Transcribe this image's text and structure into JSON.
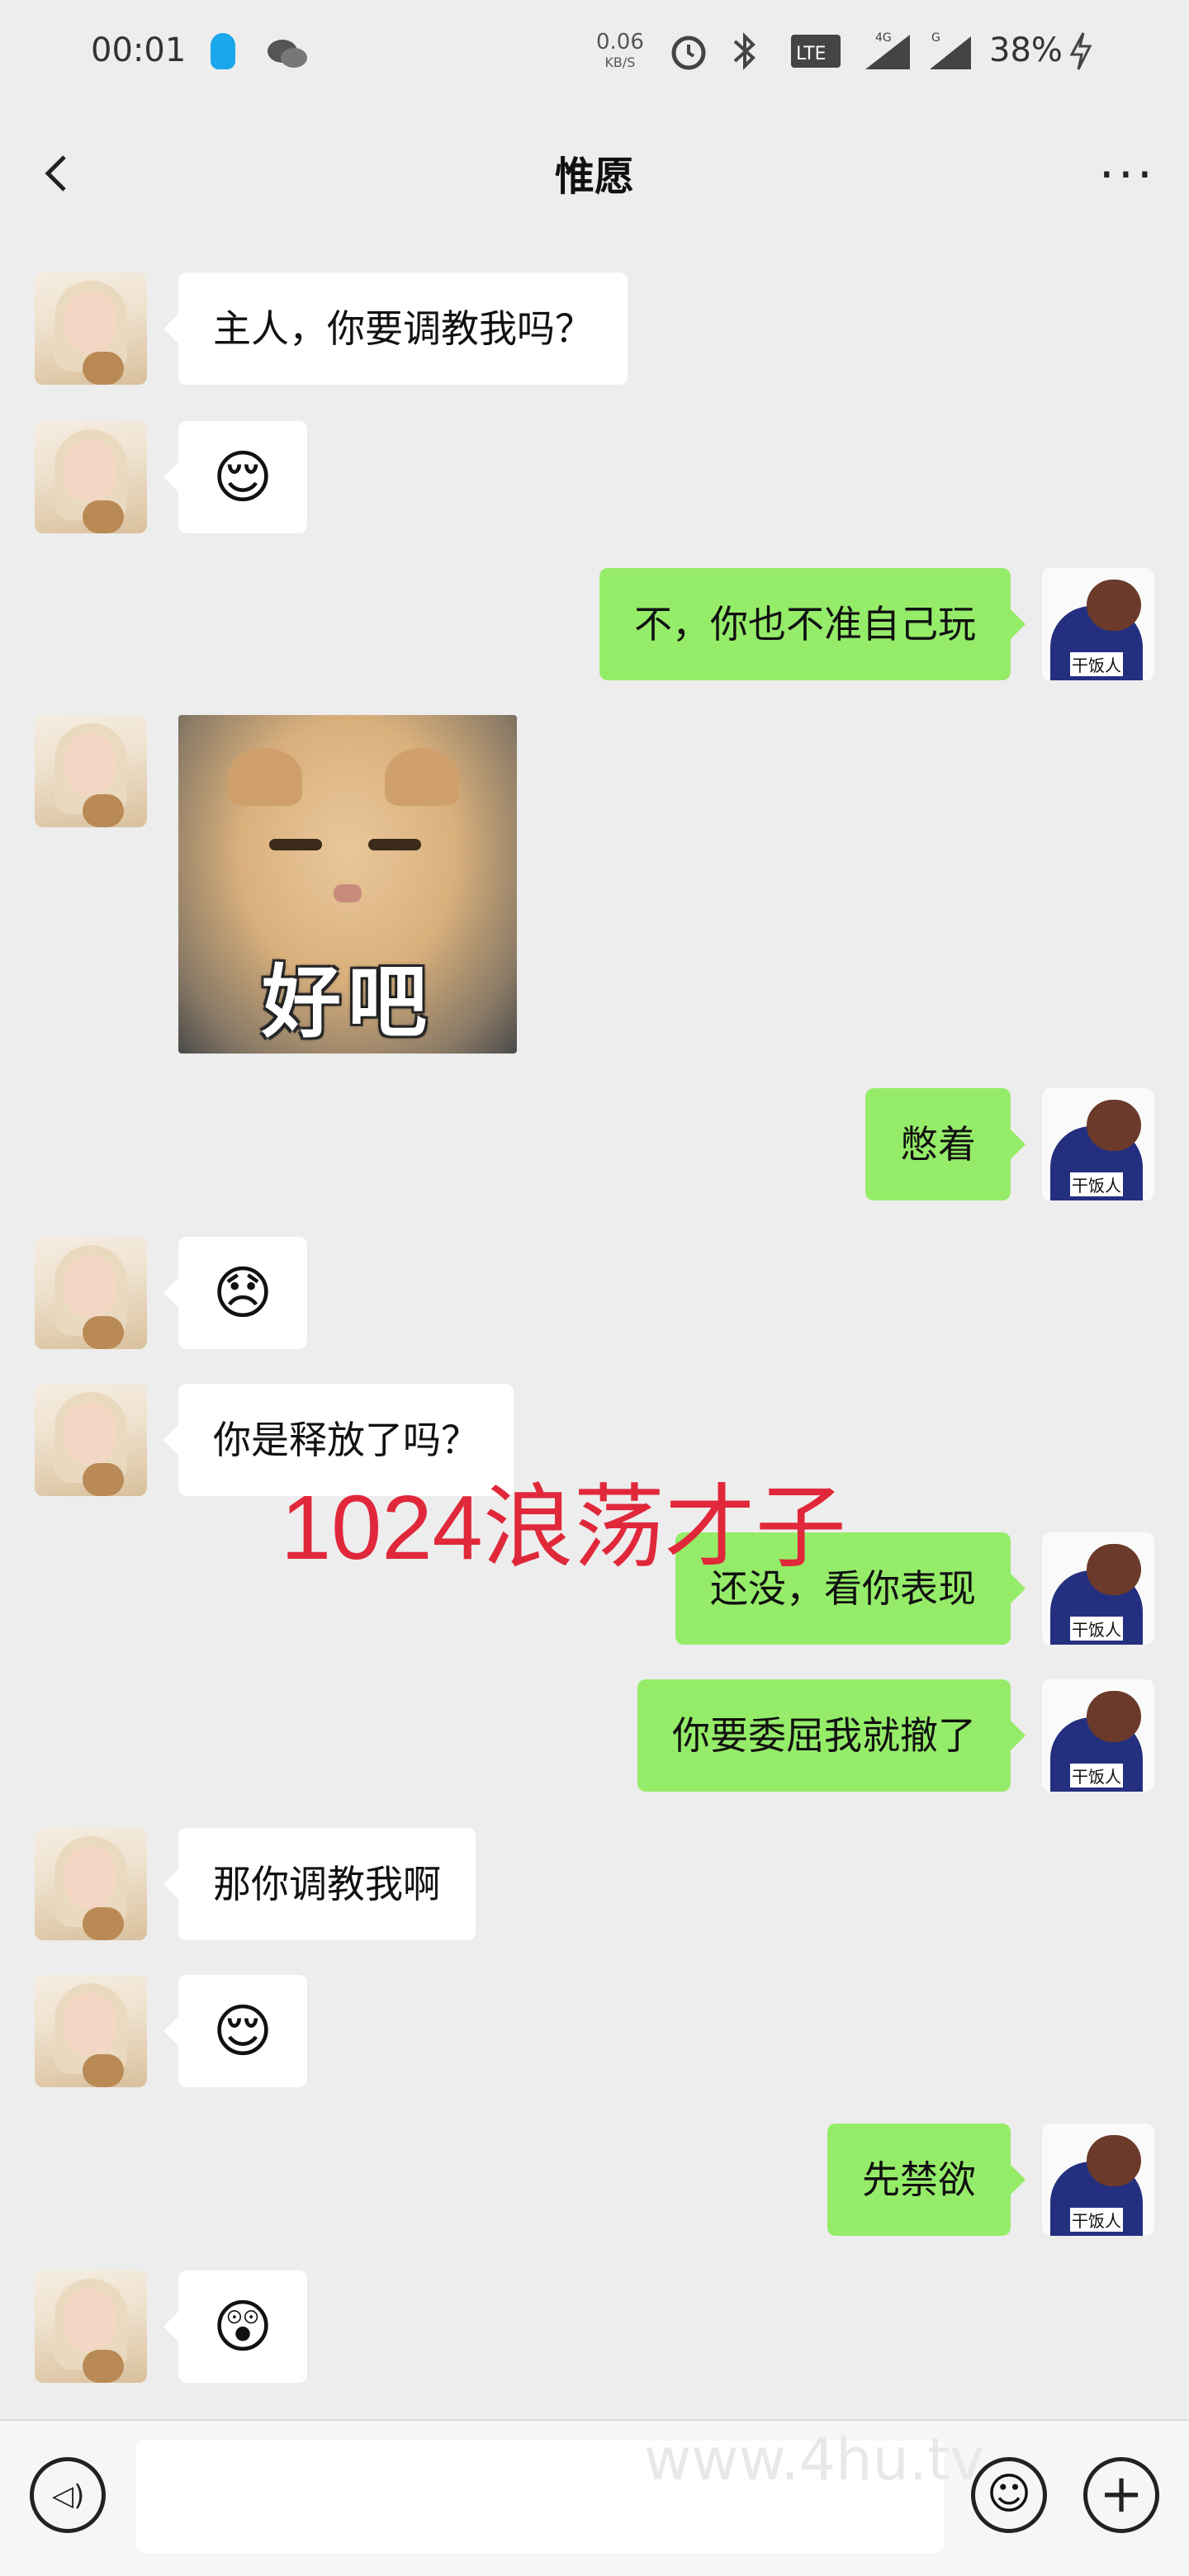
{
  "status_bar": {
    "time": "00:01",
    "net_speed": "0.06",
    "net_unit": "KB/S",
    "signal_4g": "4G",
    "signal_g": "G",
    "battery": "38%"
  },
  "header": {
    "title": "惟愿",
    "more_label": "···"
  },
  "messages": [
    {
      "side": "in",
      "type": "text",
      "text": "主人，你要调教我吗？"
    },
    {
      "side": "in",
      "type": "emoji",
      "text": "😌"
    },
    {
      "side": "out",
      "type": "text",
      "text": "不，你也不准自己玩"
    },
    {
      "side": "in",
      "type": "sticker",
      "caption": "好吧"
    },
    {
      "side": "out",
      "type": "text",
      "text": "憋着"
    },
    {
      "side": "in",
      "type": "emoji",
      "text": "😞"
    },
    {
      "side": "in",
      "type": "text",
      "text": "你是释放了吗？"
    },
    {
      "side": "out",
      "type": "text",
      "text": "还没，看你表现"
    },
    {
      "side": "out",
      "type": "text",
      "text": "你要委屈我就撤了"
    },
    {
      "side": "in",
      "type": "text",
      "text": "那你调教我啊"
    },
    {
      "side": "in",
      "type": "emoji",
      "text": "😌"
    },
    {
      "side": "out",
      "type": "text",
      "text": "先禁欲"
    },
    {
      "side": "in",
      "type": "emoji",
      "text": "😲"
    }
  ],
  "avatar_me_label": "干饭人",
  "watermark": "1024浪荡才子",
  "input_watermark": "www.4hu.tv",
  "input_bar": {
    "voice_icon": "voice-icon",
    "emoji_icon": "emoji-icon",
    "plus_icon": "plus-icon"
  }
}
